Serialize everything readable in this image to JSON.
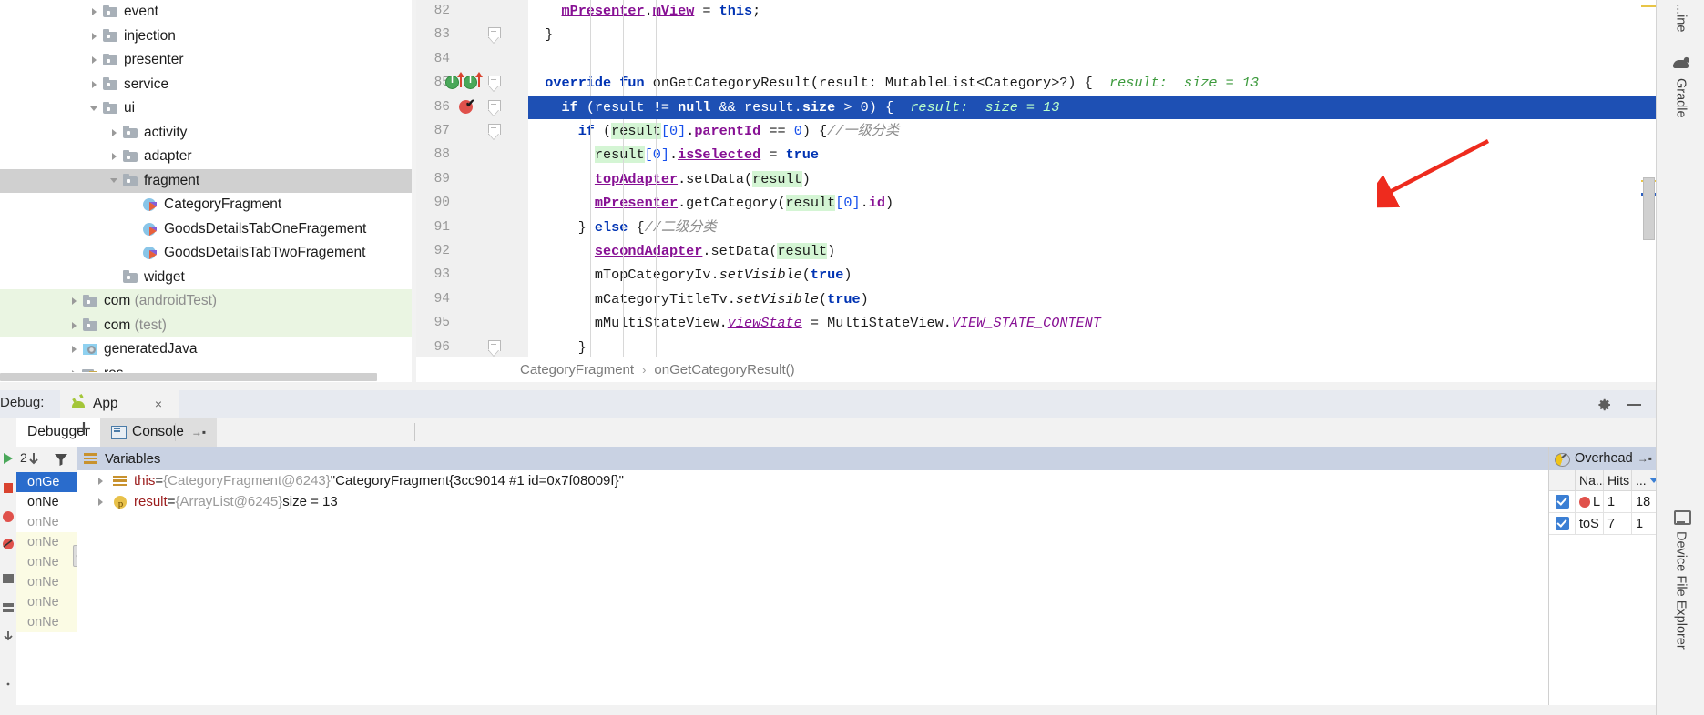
{
  "project_tree": {
    "items": [
      {
        "label": "event",
        "indent": 1,
        "arrow": "right",
        "icon": "folder-icon",
        "state": "normal"
      },
      {
        "label": "injection",
        "indent": 1,
        "arrow": "right",
        "icon": "folder-icon",
        "state": "normal"
      },
      {
        "label": "presenter",
        "indent": 1,
        "arrow": "right",
        "icon": "folder-icon",
        "state": "normal"
      },
      {
        "label": "service",
        "indent": 1,
        "arrow": "right",
        "icon": "folder-icon",
        "state": "normal"
      },
      {
        "label": "ui",
        "indent": 1,
        "arrow": "down",
        "icon": "folder-icon",
        "state": "normal"
      },
      {
        "label": "activity",
        "indent": 2,
        "arrow": "right",
        "icon": "folder-icon",
        "state": "normal"
      },
      {
        "label": "adapter",
        "indent": 2,
        "arrow": "right",
        "icon": "folder-icon",
        "state": "normal"
      },
      {
        "label": "fragment",
        "indent": 2,
        "arrow": "down",
        "icon": "folder-icon",
        "state": "selected"
      },
      {
        "label": "CategoryFragment",
        "indent": 3,
        "arrow": "none",
        "icon": "kotlin-file-icon",
        "state": "normal"
      },
      {
        "label": "GoodsDetailsTabOneFragement",
        "indent": 3,
        "arrow": "none",
        "icon": "kotlin-file-icon",
        "state": "normal"
      },
      {
        "label": "GoodsDetailsTabTwoFragement",
        "indent": 3,
        "arrow": "none",
        "icon": "kotlin-file-icon",
        "state": "normal"
      },
      {
        "label": "widget",
        "indent": 2,
        "arrow": "none",
        "icon": "folder-icon",
        "state": "normal"
      },
      {
        "label": "com",
        "suffix": " (androidTest)",
        "indent": 0,
        "arrow": "right",
        "icon": "folder-icon",
        "state": "green"
      },
      {
        "label": "com",
        "suffix": " (test)",
        "indent": 0,
        "arrow": "right",
        "icon": "folder-icon",
        "state": "green"
      },
      {
        "label": "generatedJava",
        "indent": 0,
        "arrow": "right",
        "icon": "generated-java-icon",
        "state": "normal"
      },
      {
        "label": "res",
        "indent": 0,
        "arrow": "right",
        "icon": "res-folder-icon",
        "state": "normal"
      }
    ]
  },
  "editor": {
    "lines": [
      {
        "num": "82",
        "text": "mPresenter.mView = this;",
        "gutter": "none"
      },
      {
        "num": "83",
        "text": "}",
        "gutter": "fold"
      },
      {
        "num": "84",
        "text": "",
        "gutter": "none"
      },
      {
        "num": "85",
        "text": "override fun onGetCategoryResult(result: MutableList<Category>?) {",
        "hint": "result:  size = 13",
        "gutter": "run-markers fold"
      },
      {
        "num": "86",
        "text": "if (result != null && result.size > 0) {",
        "hint": "result:  size = 13",
        "gutter": "breakpoint fold",
        "highlight": true
      },
      {
        "num": "87",
        "text": "if (result[0].parentId == 0) {",
        "comment": "//一级分类",
        "gutter": "fold"
      },
      {
        "num": "88",
        "text": "result[0].isSelected = true",
        "gutter": "none"
      },
      {
        "num": "89",
        "text": "topAdapter.setData(result)",
        "gutter": "none"
      },
      {
        "num": "90",
        "text": "mPresenter.getCategory(result[0].id)",
        "gutter": "none"
      },
      {
        "num": "91",
        "text": "} else {",
        "comment": "//二级分类",
        "gutter": "none"
      },
      {
        "num": "92",
        "text": "secondAdapter.setData(result)",
        "gutter": "none"
      },
      {
        "num": "93",
        "text": "mTopCategoryIv.setVisible(true)",
        "gutter": "none"
      },
      {
        "num": "94",
        "text": "mCategoryTitleTv.setVisible(true)",
        "gutter": "none"
      },
      {
        "num": "95",
        "text": "mMultiStateView.viewState = MultiStateView.VIEW_STATE_CONTENT",
        "gutter": "none"
      },
      {
        "num": "96",
        "text": "}",
        "gutter": "fold"
      }
    ],
    "breadcrumb": {
      "class": "CategoryFragment",
      "separator": "›",
      "method": "onGetCategoryResult()"
    }
  },
  "debug": {
    "label": "Debug:",
    "app_tab": "App",
    "close_label": "×",
    "gear_icon": "gear-icon",
    "minimize_icon": "minimize-icon",
    "tabs": [
      {
        "label": "Debugger",
        "active": true,
        "icon": null
      },
      {
        "label": "Console",
        "active": false,
        "icon": "console-icon",
        "pin": "→▪"
      }
    ],
    "toolbar": [
      {
        "name": "show-execution-point-button",
        "icon": "lines-icon"
      },
      {
        "name": "step-over-button",
        "icon": "step-over-icon"
      },
      {
        "name": "step-into-button",
        "icon": "step-into-icon"
      },
      {
        "name": "force-step-into-button",
        "icon": "force-step-into-icon"
      },
      {
        "name": "step-out-button",
        "icon": "step-out-icon"
      },
      {
        "name": "drop-frame-button",
        "icon": "drop-frame-icon"
      },
      {
        "name": "run-to-cursor-button",
        "icon": "run-to-cursor-icon"
      },
      {
        "name": "evaluate-expression-button",
        "icon": "calculator-icon"
      },
      {
        "name": "debugger-settings-button",
        "icon": "settings-sliders-icon"
      }
    ]
  },
  "frames": {
    "items": [
      {
        "label": "onGe",
        "state": "selected"
      },
      {
        "label": "onNe",
        "state": "current"
      },
      {
        "label": "onNe",
        "state": "normal"
      },
      {
        "label": "onNe",
        "state": "library"
      },
      {
        "label": "onNe",
        "state": "library"
      },
      {
        "label": "onNe",
        "state": "library"
      },
      {
        "label": "onNe",
        "state": "library"
      },
      {
        "label": "onNe",
        "state": "library"
      }
    ],
    "toolbar": {
      "thread_dump_icon": "down-arrow-icon",
      "filter_icon": "filter-funnel-icon"
    },
    "buttons": [
      {
        "name": "add-watch-button",
        "label": "+"
      },
      {
        "name": "remove-watch-button",
        "label": "−"
      },
      {
        "name": "move-up-button",
        "label": "up-triangle-icon"
      },
      {
        "name": "move-down-button",
        "label": "down-triangle-icon"
      },
      {
        "name": "copy-button",
        "label": "copy-icon"
      },
      {
        "name": "inspect-button",
        "label": "glasses-icon"
      }
    ]
  },
  "variables": {
    "header": "Variables",
    "count_badge": "2",
    "rows": [
      {
        "name": "this",
        "eq": " = ",
        "type": "{CategoryFragment@6243}",
        "value": "\"CategoryFragment{3cc9014 #1 id=0x7f08009f}\"",
        "icon": "object-value-icon"
      },
      {
        "name": "result",
        "eq": " = ",
        "type": "{ArrayList@6245}",
        "value": "size = 13",
        "icon": "parameter-icon"
      }
    ]
  },
  "overhead": {
    "title": "Overhead",
    "pin": "→▪",
    "columns": [
      "",
      "Na...",
      "Hits",
      "..."
    ],
    "rows": [
      {
        "checked": true,
        "marker": "breakpoint-dot-icon",
        "name": "L",
        "hits": "1",
        "time": "18"
      },
      {
        "checked": true,
        "marker": null,
        "name": "toS",
        "hits": "7",
        "time": "1"
      }
    ]
  },
  "right_sidebar": {
    "items": [
      {
        "label": "...ine",
        "icon": null,
        "name": "sidebar-item-gradle-line"
      },
      {
        "label": "Gradle",
        "icon": "gradle-icon",
        "name": "sidebar-item-gradle"
      },
      {
        "label": "Device File Explorer",
        "icon": "device-icon",
        "name": "sidebar-item-device-file-explorer"
      }
    ]
  },
  "colors": {
    "accent_blue": "#1e50b4",
    "breakpoint_red": "#e0514b",
    "annotation_arrow_red": "#ee2b1e",
    "keyword_blue": "#0033b3",
    "property_purple": "#871094",
    "hint_green": "#3c9a3c",
    "highlight_green": "#d4f5d4",
    "panel_header": "#c9d2e3"
  }
}
